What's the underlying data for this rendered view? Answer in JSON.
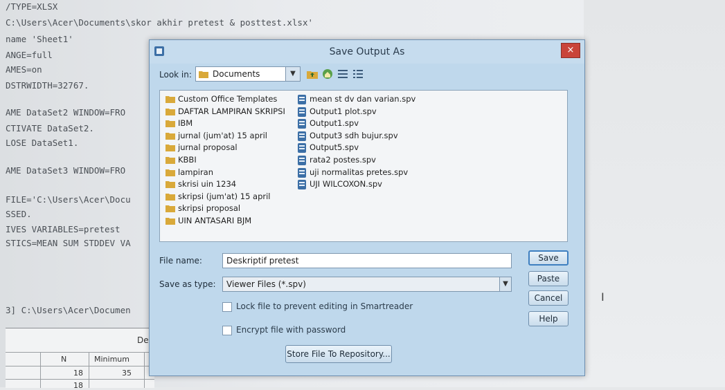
{
  "syntax_editor": {
    "lines": [
      "/TYPE=XLSX",
      "C:\\Users\\Acer\\Documents\\skor akhir pretest & posttest.xlsx'",
      "name 'Sheet1'",
      "ANGE=full",
      "AMES=on",
      "DSTRWIDTH=32767.",
      "",
      "AME DataSet2 WINDOW=FRO",
      "CTIVATE DataSet2.",
      "LOSE DataSet1.",
      "",
      "AME DataSet3 WINDOW=FRO",
      "",
      "FILE='C:\\Users\\Acer\\Docu",
      "SSED.",
      "IVES VARIABLES=pretest",
      "STICS=MEAN SUM STDDEV VA",
      "",
      "",
      "",
      "3] C:\\Users\\Acer\\Documen"
    ]
  },
  "output_table": {
    "title": "De",
    "columns": [
      "N",
      "Minimum"
    ],
    "rows": [
      [
        "18",
        "35"
      ],
      [
        "18",
        ""
      ]
    ]
  },
  "dialog": {
    "title": "Save Output As",
    "close_label": "×",
    "look_in_label": "Look in:",
    "look_in_value": "Documents",
    "files_left": [
      "Custom Office Templates",
      "DAFTAR LAMPIRAN SKRIPSI",
      "IBM",
      "jurnal (jum'at) 15 april",
      "jurnal proposal",
      "KBBI",
      "lampiran",
      "skrisi uin 1234",
      "skripsi (jum'at) 15 april",
      "skripsi proposal",
      "UIN ANTASARI BJM"
    ],
    "files_right": [
      "mean st dv dan varian.spv",
      "Output1 plot.spv",
      "Output1.spv",
      "Output3 sdh bujur.spv",
      "Output5.spv",
      "rata2 postes.spv",
      "uji normalitas pretes.spv",
      "UJI WILCOXON.spv"
    ],
    "file_name_label": "File name:",
    "file_name_value": "Deskriptif pretest",
    "save_type_label": "Save as type:",
    "save_type_value": "Viewer Files (*.spv)",
    "lock_label": "Lock file to prevent editing in Smartreader",
    "encrypt_label": "Encrypt file with password",
    "save_label": "Save",
    "paste_label": "Paste",
    "cancel_label": "Cancel",
    "help_label": "Help",
    "repository_label": "Store File To Repository..."
  },
  "colors": {
    "dialog_bg": "#bfd8ec",
    "close_red": "#c9443a",
    "folder": "#d9a93a",
    "spv_icon": "#3c6fa6"
  }
}
